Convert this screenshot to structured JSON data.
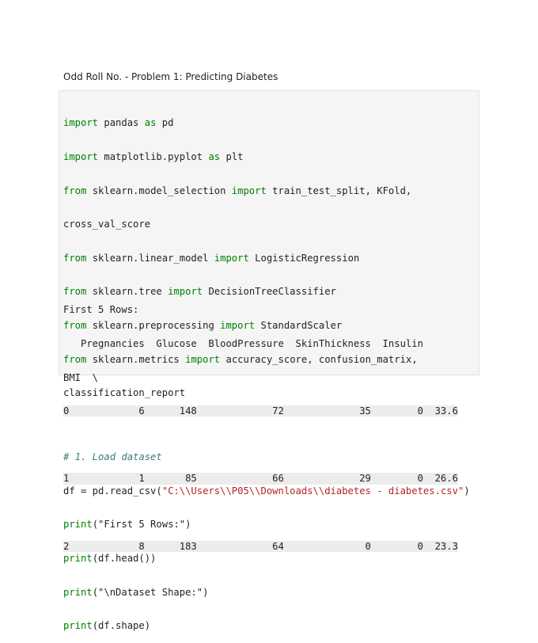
{
  "heading": "Odd Roll No. - Problem 1: Predicting Diabetes",
  "code": {
    "imports": [
      {
        "kw": "import",
        "rest": " pandas ",
        "kw2": "as",
        "tail": " pd"
      },
      {
        "kw": "import",
        "rest": " matplotlib.pyplot ",
        "kw2": "as",
        "tail": " plt"
      }
    ],
    "from_lines": [
      {
        "from": "from",
        "mod": " sklearn.model_selection ",
        "imp": "import",
        "names": " train_test_split, KFold,"
      },
      {
        "plain": "cross_val_score"
      },
      {
        "from": "from",
        "mod": " sklearn.linear_model ",
        "imp": "import",
        "names": " LogisticRegression"
      },
      {
        "from": "from",
        "mod": " sklearn.tree ",
        "imp": "import",
        "names": " DecisionTreeClassifier"
      },
      {
        "from": "from",
        "mod": " sklearn.preprocessing ",
        "imp": "import",
        "names": " StandardScaler"
      },
      {
        "from": "from",
        "mod": " sklearn.metrics ",
        "imp": "import",
        "names": " accuracy_score, confusion_matrix,"
      },
      {
        "plain": "classification_report"
      }
    ],
    "comment": "# 1. Load dataset",
    "read_csv_prefix": "df = pd.read_csv(",
    "read_csv_path": "\"C:\\\\Users\\\\P05\\\\Downloads\\\\diabetes - diabetes.csv\"",
    "read_csv_suffix": ")",
    "print1_fn": "print",
    "print1_arg": "(\"First 5 Rows:\")",
    "print2_fn": "print",
    "print2_arg": "(df.head())",
    "print3_fn": "print",
    "print3_arg": "(\"\\nDataset Shape:\")",
    "print4_fn": "print",
    "print4_arg": "(df.shape)"
  },
  "output": {
    "title": "First 5 Rows:",
    "header": "   Pregnancies  Glucose  BloodPressure  SkinThickness  Insulin   ",
    "header2": "BMI  \\",
    "rows": [
      "0            6      148             72             35        0  33.6",
      "",
      "1            1       85             66             29        0  26.6",
      "",
      "2            8      183             64              0        0  23.3"
    ]
  }
}
